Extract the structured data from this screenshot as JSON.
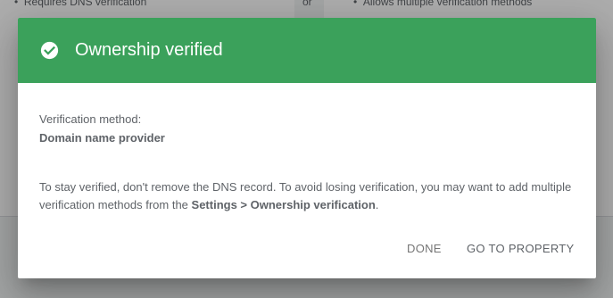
{
  "background": {
    "left_bullet": "Requires DNS verification",
    "or_text": "or",
    "right_bullet": "Allows multiple verification methods"
  },
  "dialog": {
    "title": "Ownership verified",
    "header_color": "#3ba15b",
    "check_icon": "check-circle-icon",
    "method_label": "Verification method:",
    "method_value": "Domain name provider",
    "message_part1": "To stay verified, don't remove the DNS record. To avoid losing verification, you may want to add multiple verification methods from the ",
    "message_bold": "Settings > Ownership verification",
    "message_part2": ".",
    "buttons": {
      "done": "DONE",
      "go_to_property": "GO TO PROPERTY"
    }
  }
}
